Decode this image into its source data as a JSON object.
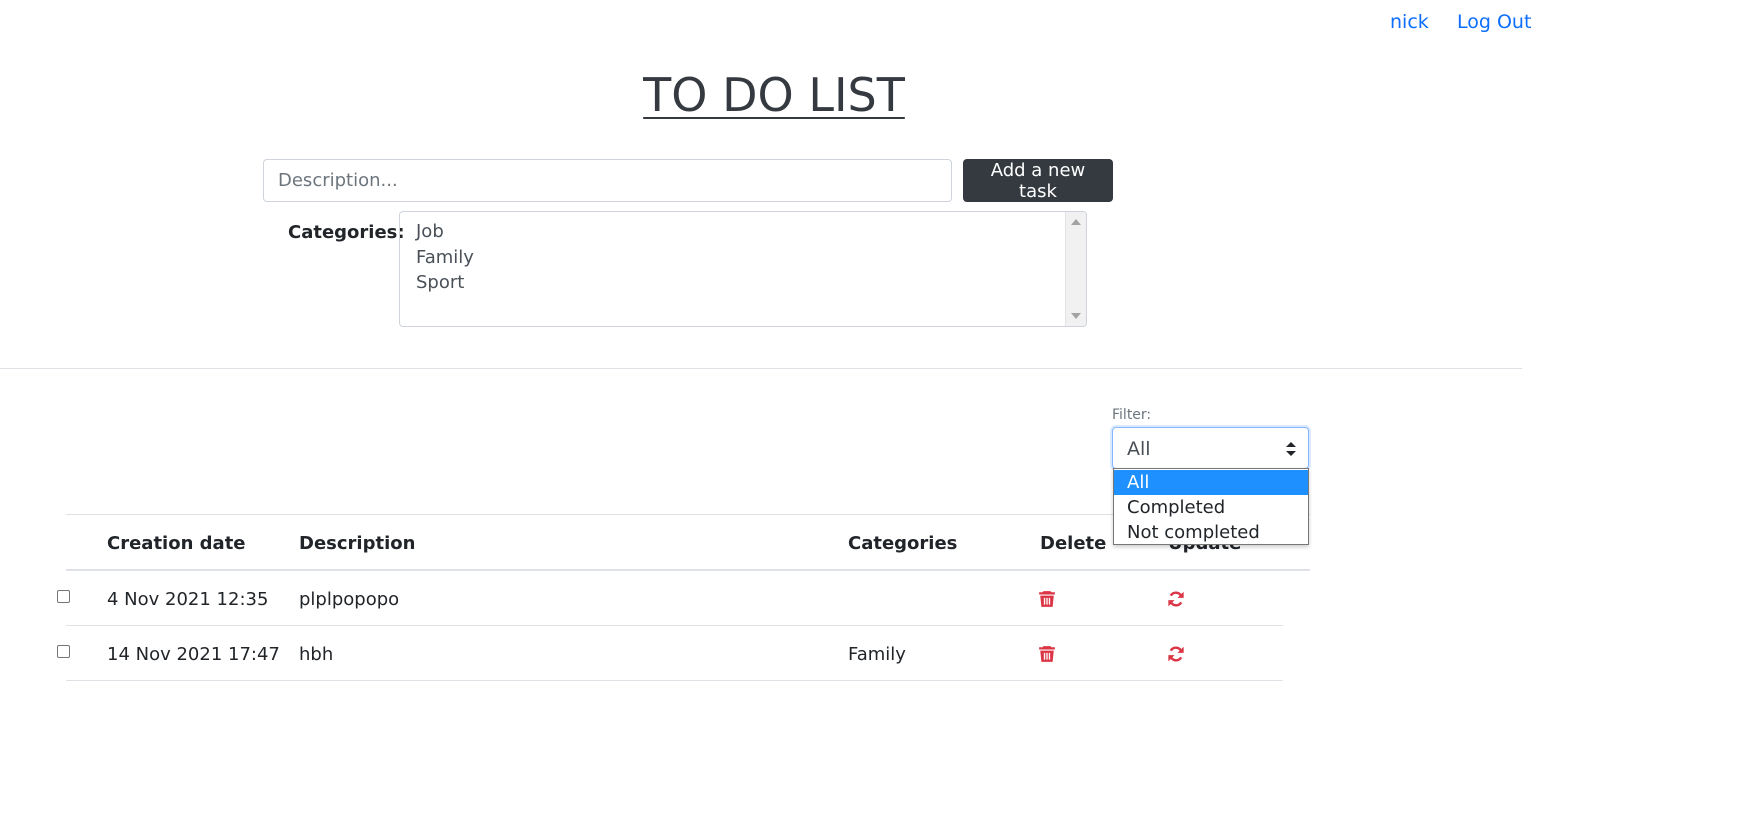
{
  "nav": {
    "user": "nick",
    "logout": "Log Out"
  },
  "title": "TO DO LIST",
  "form": {
    "description_placeholder": "Description...",
    "add_button": "Add a new task",
    "categories_label": "Categories:",
    "categories": [
      "Job",
      "Family",
      "Sport"
    ]
  },
  "filter": {
    "label": "Filter:",
    "selected": "All",
    "options": [
      "All",
      "Completed",
      "Not completed"
    ]
  },
  "table": {
    "headers": [
      "Creation date",
      "Description",
      "Categories",
      "Delete",
      "Update"
    ],
    "rows": [
      {
        "date": "4 Nov 2021 12:35",
        "description": "plplpopopo",
        "categories": "",
        "completed": false
      },
      {
        "date": "14 Nov 2021 17:47",
        "description": "hbh",
        "categories": "Family",
        "completed": false
      }
    ]
  },
  "colors": {
    "link": "#0d6efd",
    "danger": "#dc3545",
    "dark": "#343a40",
    "selected_option": "#1e90ff"
  },
  "icons": {
    "delete": "trash-icon",
    "update": "refresh-icon"
  }
}
